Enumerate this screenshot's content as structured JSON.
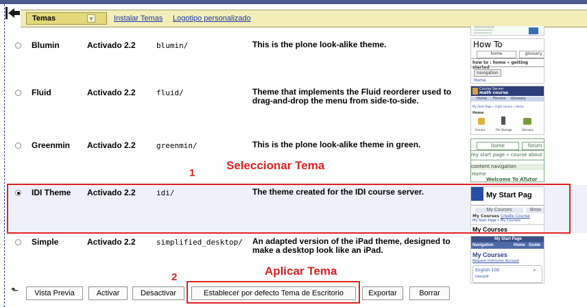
{
  "tabs": {
    "active": "Temas",
    "install": "Instalar Temas",
    "logo": "Logotipo personalizado"
  },
  "themes": [
    {
      "name": "Blumin",
      "status": "Activado 2.2",
      "dir": "blumin/",
      "desc": "This is the plone look-alike theme.",
      "selected": false
    },
    {
      "name": "Fluid",
      "status": "Activado 2.2",
      "dir": "fluid/",
      "desc": "Theme that implements the Fluid reorderer used to drag-and-drop the menu from side-to-side.",
      "selected": false
    },
    {
      "name": "Greenmin",
      "status": "Activado 2.2",
      "dir": "greenmin/",
      "desc": "This is the plone look-alike theme in green.",
      "selected": false
    },
    {
      "name": "IDI Theme",
      "status": "Activado 2.2",
      "dir": "idi/",
      "desc": "The theme created for the IDI course server.",
      "selected": true
    },
    {
      "name": "Simple",
      "status": "Activado 2.2",
      "dir": "simplified_desktop/",
      "desc": "An adapted version of the iPad theme, designed to make a desktop look like an iPad.",
      "selected": false
    }
  ],
  "thumbs": {
    "blumin": {
      "title": "How To",
      "tab1": "home",
      "tab2": "glossary",
      "crumb": "how to : home » getting started",
      "nav": "navigation",
      "home": "Home"
    },
    "fluid": {
      "server": "Course Server",
      "course": "math course",
      "nav1": "Home",
      "nav2": "Forums",
      "nav3": "Glossary",
      "crumb": "My Start Page » math course » Home",
      "home": "Home",
      "i1": "Forums",
      "i2": "File Storage",
      "i3": "Glossary"
    },
    "greenmin": {
      "tab1": "home",
      "tab2": "forum",
      "crumb": "my start page » course about b",
      "nav": "content navigation",
      "home": "Home",
      "welcome": "Welcome To ATutor"
    },
    "idi": {
      "title": "My Start Pag",
      "t1": "My Courses",
      "t2": "Brow",
      "l1": "My Courses",
      "l2": "Create Course",
      "crumb": "My Start Page » My Courses",
      "heading": "My Courses"
    },
    "simple": {
      "top": "My Start Page",
      "nav": "Navigation",
      "home": "Home",
      "guide": "Guide",
      "heading": "My Courses",
      "link": "Request Instructor Account",
      "c1": "English 100",
      "c2": "Userpdf"
    }
  },
  "annotations": {
    "step1_num": "1",
    "step1_label": "Seleccionar Tema",
    "step2_num": "2",
    "step2_label": "Aplicar Tema"
  },
  "buttons": {
    "preview": "Vista Previa",
    "activate": "Activar",
    "deactivate": "Desactivar",
    "set_default": "Establecer por defecto Tema de Escritorio",
    "export": "Exportar",
    "delete": "Borrar"
  },
  "colors": {
    "accent_red": "#e02020",
    "tab_bg": "#f3eeb8",
    "link": "#1a34a8"
  }
}
